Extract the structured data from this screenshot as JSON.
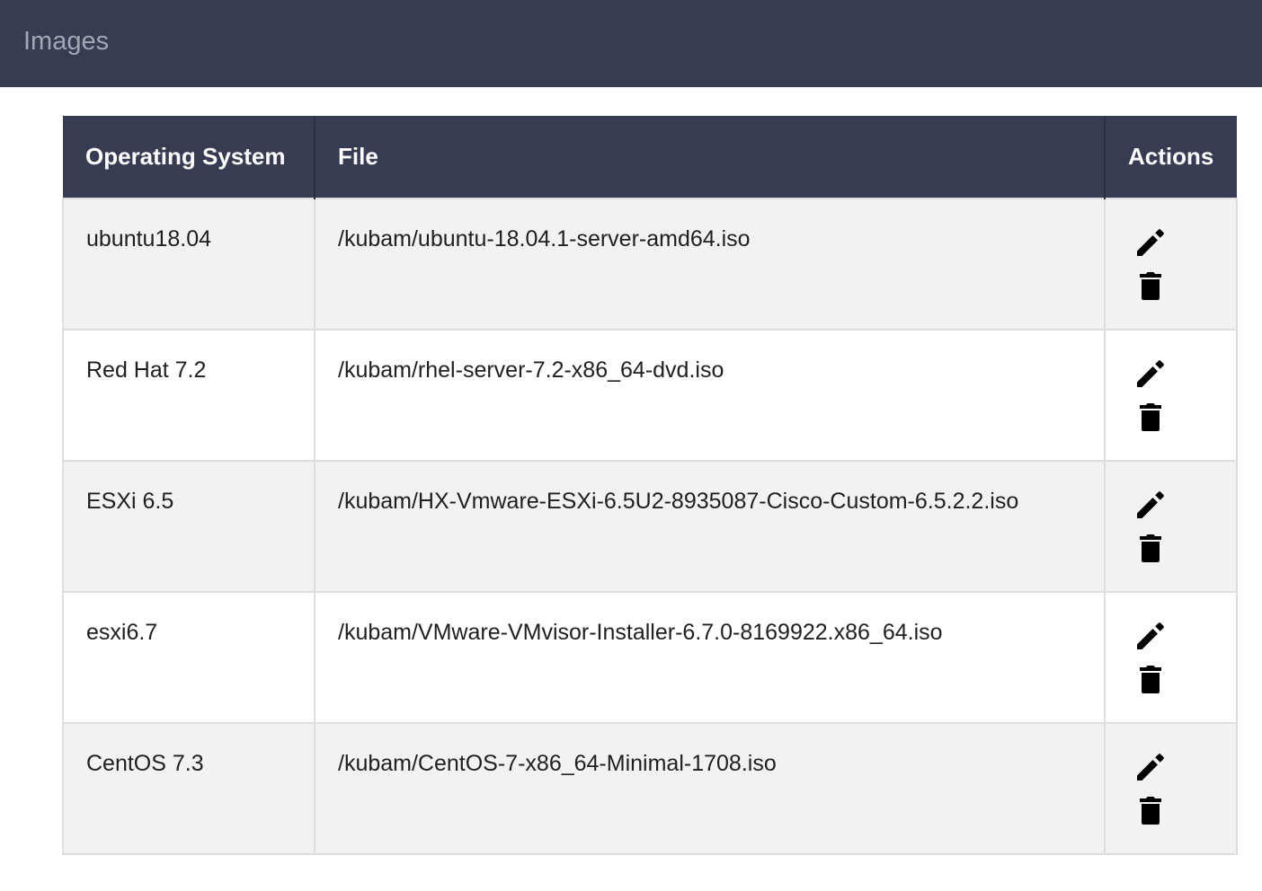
{
  "header": {
    "title": "Images"
  },
  "table": {
    "columns": [
      "Operating System",
      "File",
      "Actions"
    ],
    "rows": [
      {
        "os": "ubuntu18.04",
        "file": "/kubam/ubuntu-18.04.1-server-amd64.iso"
      },
      {
        "os": "Red Hat 7.2",
        "file": "/kubam/rhel-server-7.2-x86_64-dvd.iso"
      },
      {
        "os": "ESXi 6.5",
        "file": "/kubam/HX-Vmware-ESXi-6.5U2-8935087-Cisco-Custom-6.5.2.2.iso"
      },
      {
        "os": "esxi6.7",
        "file": "/kubam/VMware-VMvisor-Installer-6.7.0-8169922.x86_64.iso"
      },
      {
        "os": "CentOS 7.3",
        "file": "/kubam/CentOS-7-x86_64-Minimal-1708.iso"
      }
    ]
  },
  "icons": {
    "edit": "pencil-icon",
    "delete": "trash-icon"
  },
  "colors": {
    "header_bg": "#383c52",
    "header_title": "#a3a6b4",
    "row_odd": "#f2f2f2",
    "row_even": "#ffffff"
  }
}
